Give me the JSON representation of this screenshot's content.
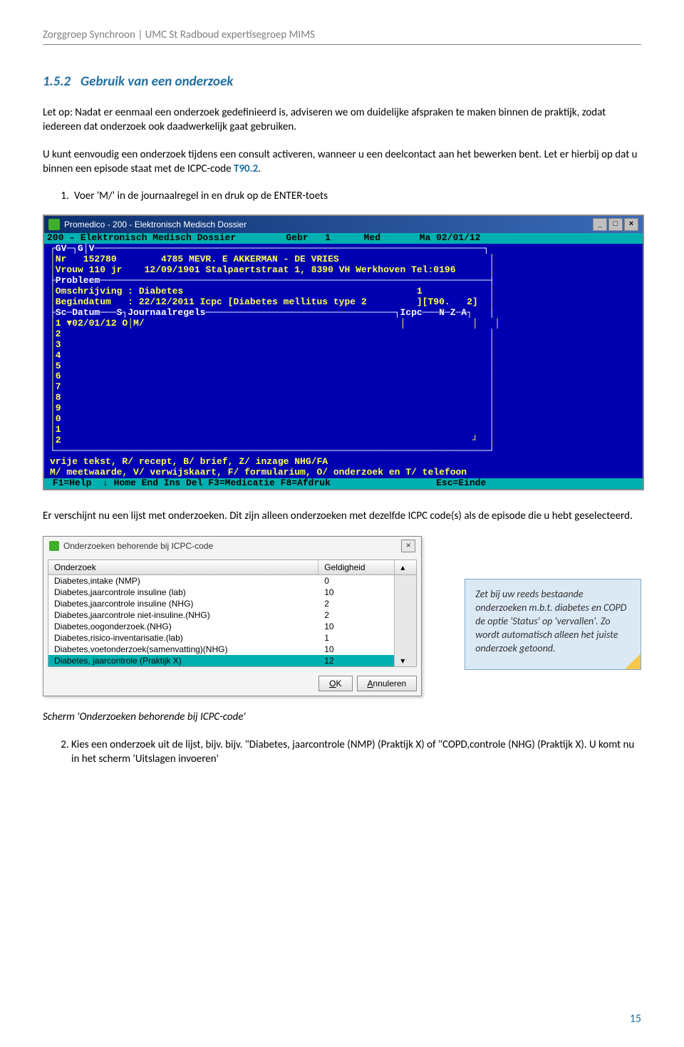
{
  "header": "Zorggroep Synchroon | UMC St Radboud expertisegroep MIMS",
  "section": {
    "num": "1.5.2",
    "title": "Gebruik van een onderzoek"
  },
  "para1": "Let op: Nadat er eenmaal een onderzoek gedefinieerd is, adviseren we om duidelijke afspraken te maken binnen de praktijk, zodat iedereen dat onderzoek ook daadwerkelijk gaat gebruiken.",
  "para2_a": "U kunt eenvoudig een onderzoek tijdens een consult activeren, wanneer u een deelcontact aan het bewerken bent. Let er hierbij op dat u binnen een episode staat met de ICPC-code ",
  "para2_code": "T90.2",
  "para2_b": ".",
  "step1": "Voer  'M/' in de journaalregel in en druk op de ENTER-toets",
  "dos": {
    "title": "Promedico - 200 - Elektronisch Medisch Dossier",
    "topbar": "200 - Elektronisch Medisch Dossier         Gebr   1      Med       Ma 02/01/12",
    "lines": [
      "┌GV─┐G│V──────────────────────────────────────────────────────────────────────┐",
      "│Nr   152780        4785 MEVR. E AKKERMAN - DE VRIES                           │",
      "│Vrouw 110 jr    12/09/1901 Stalpaertstraat 1, 8390 VH Werkhoven Tel:0196      │",
      "├Probleem──────────────────────────────────────────────────────────────────────┤",
      "│Omschrijving : Diabetes                                          1            │",
      "│Begindatum   : 22/12/2011 Icpc [Diabetes mellitus type 2         ][T90.   2]  │",
      "├Sc─Datum───S┐Journaalregels──────────────────────────────────┐Icpc───N─Z─A┐   │",
      "│1 ▼02/01/12 O│M/                                              │            │   │",
      "│2                                                                             │",
      "│3                                                                             │",
      "│4                                                                             │",
      "│5                                                                             │",
      "│6                                                                             │",
      "│7                                                                             │",
      "│8                                                                             │",
      "│9                                                                             │",
      "│0                                                                             │",
      "│1                                                                             │",
      "│2                                                                          ┘  │",
      "└──────────────────────────────────────────────────────────────────────────────┘"
    ],
    "help1": "vrije tekst, R/ recept, B/ brief, Z/ inzage NHG/FA",
    "help2": "M/ meetwaarde, V/ verwijskaart, F/ formularium, O/ onderzoek en T/ telefoon",
    "footer": " F1=Help  ↓ Home End Ins Del F3=Medicatie F8=Afdruk                   Esc=Einde "
  },
  "para3": "Er verschijnt nu een lijst met onderzoeken. Dit zijn alleen onderzoeken met dezelfde ICPC code(s) als de episode die u hebt geselecteerd.",
  "dialog": {
    "title": "Onderzoeken behorende bij ICPC-code",
    "col1": "Onderzoek",
    "col2": "Geldigheid",
    "rows": [
      {
        "name": "Diabetes,intake (NMP)",
        "val": "0"
      },
      {
        "name": "Diabetes,jaarcontrole insuline (lab)",
        "val": "10"
      },
      {
        "name": "Diabetes,jaarcontrole insuline (NHG)",
        "val": "2"
      },
      {
        "name": "Diabetes,jaarcontrole niet-insuline.(NHG)",
        "val": "2"
      },
      {
        "name": "Diabetes,oogonderzoek.(NHG)",
        "val": "10"
      },
      {
        "name": "Diabetes,risico-inventarisatie.(lab)",
        "val": "1"
      },
      {
        "name": "Diabetes,voetonderzoek(samenvatting)(NHG)",
        "val": "10"
      },
      {
        "name": "Diabetes, jaarcontrole (Praktijk X)",
        "val": "12",
        "selected": true
      }
    ],
    "ok": "OK",
    "cancel": "Annuleren"
  },
  "sticky": "Zet bij uw reeds bestaande onderzoeken m.b.t. diabetes en COPD de optie 'Status' op 'vervallen'. Zo wordt automatisch alleen het juiste onderzoek getoond.",
  "caption": "Scherm 'Onderzoeken behorende bij ICPC-code'",
  "step2": "Kies een onderzoek uit de lijst, bijv. bijv. \"Diabetes, jaarcontrole (NMP)  (Praktijk X) of \"COPD,controle (NHG) (Praktijk X). U komt nu in het scherm 'Uitslagen invoeren'",
  "pagenum": "15"
}
